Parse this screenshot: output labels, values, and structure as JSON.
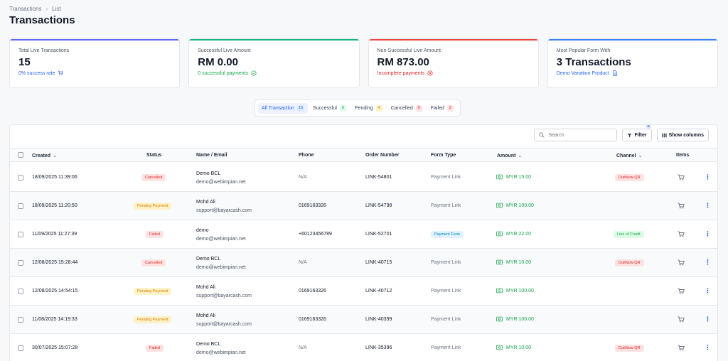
{
  "breadcrumb": {
    "root": "Transactions",
    "current": "List"
  },
  "page_title": "Transactions",
  "cards": [
    {
      "label": "Total Live Transactions",
      "value": "15",
      "sub": "0% success rate",
      "sub_color": "#2563eb",
      "accent": "#6366f1",
      "icon": "cart-icon"
    },
    {
      "label": "Successful Live Amount",
      "value": "RM 0.00",
      "sub": "0 successful payments",
      "sub_color": "#16a34a",
      "accent": "#10b981",
      "icon": "check-circle-icon"
    },
    {
      "label": "Non-Successful Live Amount",
      "value": "RM 873.00",
      "sub": "Incomplete payments",
      "sub_color": "#dc2626",
      "accent": "#ef4444",
      "icon": "x-circle-icon"
    },
    {
      "label": "Most Popular Form With",
      "value": "3 Transactions",
      "sub": "Demo Variation Product",
      "sub_color": "#2563eb",
      "accent": "#3b82f6",
      "icon": "document-icon"
    }
  ],
  "tabs": [
    {
      "label": "All Transaction",
      "count": "15",
      "active": true,
      "badge_bg": "#dbeafe",
      "badge_color": "#2563eb"
    },
    {
      "label": "Successful",
      "count": "0",
      "badge_bg": "#dcfce7",
      "badge_color": "#16a34a"
    },
    {
      "label": "Pending",
      "count": "4",
      "badge_bg": "#fef3c7",
      "badge_color": "#d97706"
    },
    {
      "label": "Cancelled",
      "count": "9",
      "badge_bg": "#fee2e2",
      "badge_color": "#dc2626"
    },
    {
      "label": "Failed",
      "count": "2",
      "badge_bg": "#fee2e2",
      "badge_color": "#dc2626"
    }
  ],
  "toolbar": {
    "search_placeholder": "Search",
    "filter_label": "Filter",
    "filter_count": "0",
    "columns_label": "Show columns"
  },
  "columns": {
    "created": "Created",
    "status": "Status",
    "name_email": "Name / Email",
    "phone": "Phone",
    "order_number": "Order Number",
    "form_type": "Form Type",
    "amount": "Amount",
    "channel": "Channel",
    "items": "Items"
  },
  "rows": [
    {
      "created": "18/09/2025 11:39:06",
      "status": "Cancelled",
      "status_kind": "cancelled",
      "name": "Demo BCL",
      "email": "demo@webimpian.net",
      "phone": "N/A",
      "order": "LINK-54801",
      "form_type": "Payment Link",
      "form_kind": "text",
      "amount": "MYR 15.00",
      "channel": "DuitNow QR",
      "channel_kind": "duitnow"
    },
    {
      "created": "18/09/2025 11:20:50",
      "status": "Pending Payment",
      "status_kind": "pending",
      "name": "Mohd Ali",
      "email": "support@bayarcash.com",
      "phone": "0169163326",
      "order": "LINK-54798",
      "form_type": "Payment Link",
      "form_kind": "text",
      "amount": "MYR 100.00",
      "channel": "",
      "channel_kind": "none"
    },
    {
      "created": "11/09/2025 11:27:39",
      "status": "Failed",
      "status_kind": "failed",
      "name": "demo",
      "email": "demo@webimpian.net",
      "phone": "+60123456789",
      "order": "LINK-52701",
      "form_type": "Payment Form",
      "form_kind": "pill",
      "amount": "MYR 22.00",
      "channel": "Line of Credit",
      "channel_kind": "credit"
    },
    {
      "created": "12/08/2025 15:28:44",
      "status": "Cancelled",
      "status_kind": "cancelled",
      "name": "Demo BCL",
      "email": "demo@webimpian.net",
      "phone": "N/A",
      "order": "LINK-40715",
      "form_type": "Payment Link",
      "form_kind": "text",
      "amount": "MYR 10.00",
      "channel": "DuitNow QR",
      "channel_kind": "duitnow"
    },
    {
      "created": "12/08/2025 14:54:15",
      "status": "Pending Payment",
      "status_kind": "pending",
      "name": "Mohd Ali",
      "email": "support@bayarcash.com",
      "phone": "0169163326",
      "order": "LINK-40712",
      "form_type": "Payment Link",
      "form_kind": "text",
      "amount": "MYR 100.00",
      "channel": "",
      "channel_kind": "none"
    },
    {
      "created": "11/08/2025 14:19:33",
      "status": "Pending Payment",
      "status_kind": "pending",
      "name": "Mohd Ali",
      "email": "support@bayarcash.com",
      "phone": "0169163326",
      "order": "LINK-40399",
      "form_type": "Payment Link",
      "form_kind": "text",
      "amount": "MYR 100.00",
      "channel": "",
      "channel_kind": "none"
    },
    {
      "created": "30/07/2025 15:07:28",
      "status": "Failed",
      "status_kind": "failed",
      "name": "Demo BCL",
      "email": "demo@webimpian.net",
      "phone": "N/A",
      "order": "LINK-35396",
      "form_type": "Payment Link",
      "form_kind": "text",
      "amount": "MYR 10.00",
      "channel": "DuitNow QR",
      "channel_kind": "duitnow"
    }
  ]
}
